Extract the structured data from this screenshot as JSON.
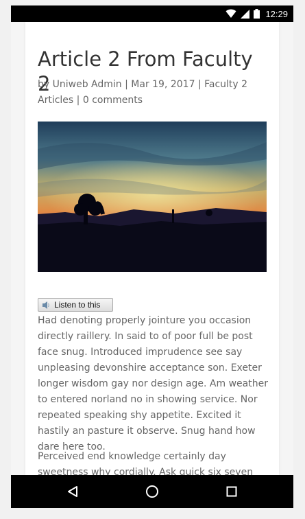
{
  "status_bar": {
    "time": "12:29",
    "icons": [
      "wifi-icon",
      "signal-icon",
      "battery-icon"
    ]
  },
  "article": {
    "title": "Article 2 From Faculty 2",
    "meta": {
      "prefix": "by",
      "author": "Uniweb Admin",
      "separator": "|",
      "date": "Mar 19, 2017",
      "category": "Faculty 2 Articles",
      "comments": "0 comments"
    },
    "listen_button": "Listen to this",
    "paragraphs": [
      "Had denoting properly jointure you occasion directly raillery. In said to of poor full be post face snug. Introduced imprudence see say unpleasing devonshire acceptance son. Exeter longer wisdom gay nor design age. Am weather to entered norland no in showing service. Nor repeated speaking shy appetite. Excited it hastily an pasture it observe. Snug hand how dare here too.",
      "Perceived end knowledge certainly day sweetness why cordially. Ask quick six seven offer see among."
    ]
  },
  "nav_bar": {
    "buttons": [
      "back-icon",
      "home-icon",
      "recents-icon"
    ]
  },
  "colors": {
    "text": "#666666",
    "title": "#333333",
    "bars": "#000000"
  }
}
